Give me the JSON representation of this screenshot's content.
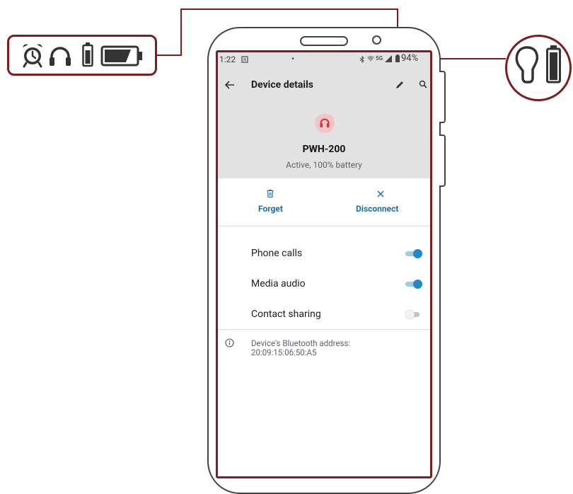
{
  "status_bar": {
    "time": "1:22",
    "battery": "94%",
    "network": "5G"
  },
  "screen": {
    "title": "Device details",
    "device_name": "PWH-200",
    "device_status": "Active, 100% battery",
    "actions": [
      {
        "label": "Forget",
        "icon": "trash-icon"
      },
      {
        "label": "Disconnect",
        "icon": "close-icon"
      }
    ],
    "settings": [
      {
        "label": "Phone calls",
        "enabled": true
      },
      {
        "label": "Media audio",
        "enabled": true
      },
      {
        "label": "Contact sharing",
        "enabled": false
      }
    ],
    "bt_address_label": "Device's Bluetooth address:",
    "bt_address": "20:09:15:06:50:A5"
  },
  "colors": {
    "accent": "#1a6fa8",
    "toggle_on": "#2188c9",
    "headset_icon": "#d2343c",
    "callout": "#7b1e1e"
  },
  "callout_icons_left": [
    "alarm-clock-icon",
    "headphones-icon",
    "battery-vertical-icon",
    "battery-horizontal-icon"
  ],
  "callout_icons_right": [
    "earbud-icon",
    "battery-icon"
  ]
}
